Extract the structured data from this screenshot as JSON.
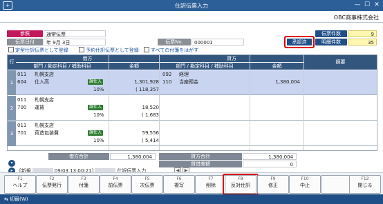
{
  "window": {
    "title": "仕訳伝票入力",
    "company": "OBC商事株式会社",
    "minimize": "—",
    "maximize": "☐",
    "close": "✕",
    "app_icon": "+"
  },
  "header": {
    "ref_label": "参照",
    "ref_value": "通常伝票",
    "date_label": "伝票日付",
    "date_value": "年  9月  3日",
    "voucher_no_label": "伝票No.",
    "voucher_no_value": "000001",
    "status": "承認済",
    "count_label": "伝票件数",
    "count_value": "9",
    "detail_count_label": "明細件数",
    "detail_count_value": "35"
  },
  "links": {
    "fixed": "定型仕訳伝票として登録",
    "scheduled": "予約仕訳伝票として登録",
    "remove_attachments": "すべての付箋をはがす"
  },
  "grid": {
    "header": {
      "row": "行",
      "debit": "借方",
      "credit": "貸方",
      "memo": "摘要",
      "dept_account": "部門 / 勘定科目 / 補助科目",
      "amount": "金額",
      "dept_account2": "部門 / 勘定科目 / 補助科目",
      "amount2": "金額"
    },
    "rows": [
      {
        "no": "1",
        "debit": {
          "dept_code": "011",
          "dept_name": "札幌支店",
          "acct_code": "604",
          "acct_name": "仕入高",
          "tax_badge": "課仕入",
          "tax_rate": "10%",
          "amount": "1,301,928",
          "tax_amount": "( 118,357"
        },
        "credit": {
          "dept_code": "092",
          "dept_name": "経理",
          "acct_code": "110",
          "acct_name": "当座預金",
          "amount": "1,380,004"
        }
      },
      {
        "no": "2",
        "debit": {
          "dept_code": "011",
          "dept_name": "札幌支店",
          "acct_code": "700",
          "acct_name": "運賃",
          "tax_badge": "課仕入",
          "tax_rate": "10%",
          "amount": "18,520",
          "tax_amount": "( 1,683"
        }
      },
      {
        "no": "3",
        "debit": {
          "dept_code": "011",
          "dept_name": "札幌支店",
          "acct_code": "701",
          "acct_name": "荷造包装費",
          "tax_badge": "課仕入",
          "tax_rate": "10%",
          "amount": "59,556",
          "tax_amount": "( 5,414"
        }
      }
    ]
  },
  "totals": {
    "debit_label": "借方合計",
    "debit_value": "1,380,004",
    "credit_label": "貸方合計",
    "credit_value": "1,380,004",
    "diff_label": "貸借差額",
    "diff_value": "0"
  },
  "status_line": {
    "new": "[新規",
    "timestamp": "09/03 13:00:21]",
    "screen": "仕訳伝票入力"
  },
  "fkeys": [
    {
      "key": "F1",
      "label": "ヘルプ"
    },
    {
      "key": "F2",
      "label": "伝票発行"
    },
    {
      "key": "F3",
      "label": "付箋"
    },
    {
      "key": "F4",
      "label": "前伝票"
    },
    {
      "key": "F5",
      "label": "次伝票"
    },
    {
      "key": "F6",
      "label": "複写"
    },
    {
      "key": "F7",
      "label": "削除"
    },
    {
      "key": "F8",
      "label": "反対仕訳"
    },
    {
      "key": "F9",
      "label": "修正"
    },
    {
      "key": "F10",
      "label": "中止"
    },
    {
      "key": "",
      "label": ""
    },
    {
      "key": "F12",
      "label": "閉じる"
    }
  ],
  "bottom": {
    "switch_label": "切替(W)"
  }
}
